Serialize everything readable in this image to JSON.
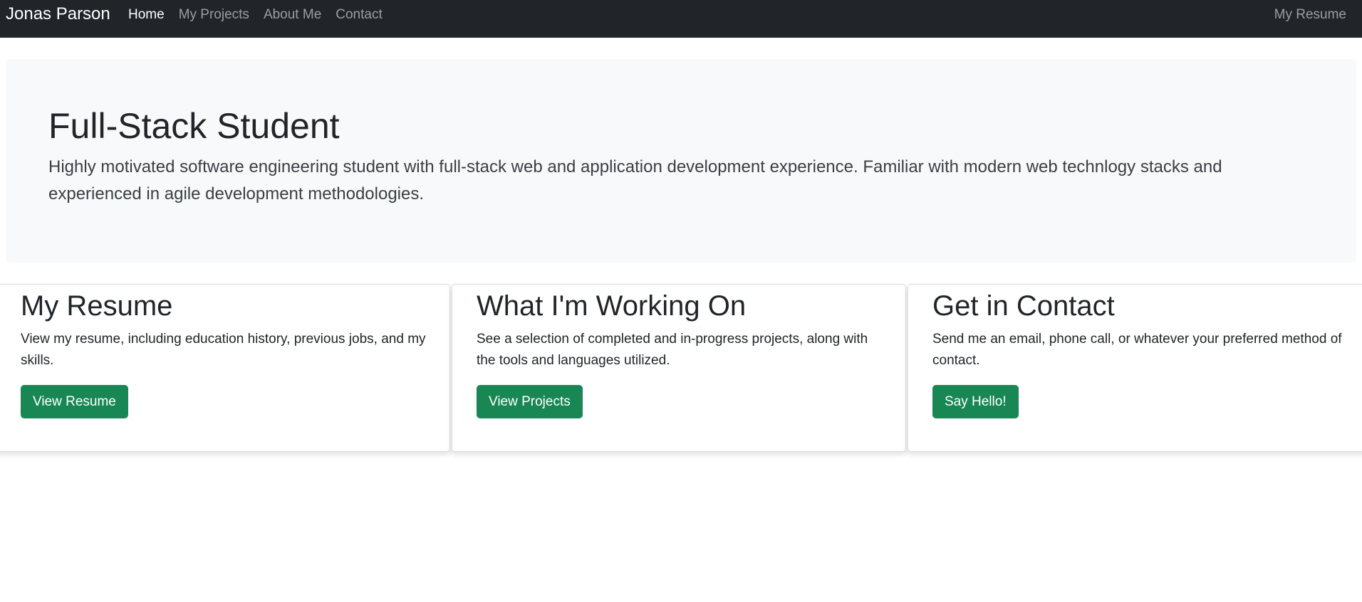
{
  "navbar": {
    "brand": "Jonas Parson",
    "links": [
      {
        "label": "Home",
        "active": true
      },
      {
        "label": "My Projects",
        "active": false
      },
      {
        "label": "About Me",
        "active": false
      },
      {
        "label": "Contact",
        "active": false
      }
    ],
    "right_link": "My Resume"
  },
  "hero": {
    "title": "Full-Stack Student",
    "text": "Highly motivated software engineering student with full-stack web and application development experience. Familiar with modern web technlogy stacks and experienced in agile development methodologies."
  },
  "cards": [
    {
      "title": "My Resume",
      "text": "View my resume, including education history, previous jobs, and my skills.",
      "button": "View Resume"
    },
    {
      "title": "What I'm Working On",
      "text": "See a selection of completed and in-progress projects, along with the tools and languages utilized.",
      "button": "View Projects"
    },
    {
      "title": "Get in Contact",
      "text": "Send me an email, phone call, or whatever your preferred method of contact.",
      "button": "Say Hello!"
    }
  ],
  "colors": {
    "navbar_bg": "#212529",
    "hero_bg": "#f8f9fa",
    "button_bg": "#198754"
  }
}
